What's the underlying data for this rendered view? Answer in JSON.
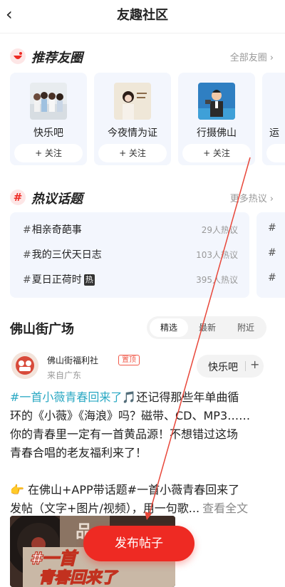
{
  "nav": {
    "back_label": "‹",
    "title": "友趣社区"
  },
  "recommend": {
    "title": "推荐友圈",
    "more": "全部友圈",
    "groups": [
      {
        "name": "快乐吧",
        "follow": "+ 关注"
      },
      {
        "name": "今夜情为证",
        "follow": "+ 关注"
      },
      {
        "name": "行摄佛山",
        "follow": "+ 关注"
      },
      {
        "name": "运",
        "follow": ""
      }
    ],
    "thumb_text": "今夜情为证"
  },
  "hot": {
    "title": "热议话题",
    "more": "更多热议",
    "topics": [
      {
        "name": "相亲奇葩事",
        "heat": "29人热议",
        "badge": ""
      },
      {
        "name": "我的三伏天日志",
        "heat": "103人热议",
        "badge": ""
      },
      {
        "name": "夏日正荷时",
        "heat": "395人热议",
        "badge": "热"
      }
    ],
    "side_hash": "#"
  },
  "plaza": {
    "title": "佛山街广场",
    "tabs": [
      "精选",
      "最新",
      "附近"
    ]
  },
  "post": {
    "author": "佛山街福利社",
    "pin": "置顶",
    "from": "来自广东",
    "group": "快乐吧",
    "group_plus": "+",
    "lines": {
      "l1_tag": "#一首小薇青春回来了",
      "l1_rest": "🎵还记得那些年单曲循",
      "l2": "环的《小薇》《海浪》吗？磁带、CD、MP3……",
      "l3": "你的青春里一定有一首黄品源！不想错过这场",
      "l4": "青春合唱的老友福利来了！",
      "l5": "👉 在佛山+APP带话题#一首小薇青春回来了",
      "l6": "发帖（文字+图片/视频），用一句歌...",
      "see_all": "查看全文"
    },
    "image_text_1": "#一首",
    "image_text_2": "青春回来了",
    "image_text_3": "品"
  },
  "publish_label": "发布帖子",
  "colors": {
    "accent": "#ee2a23",
    "tag": "#2aa8c3",
    "card_bg": "#f3f6fd"
  }
}
